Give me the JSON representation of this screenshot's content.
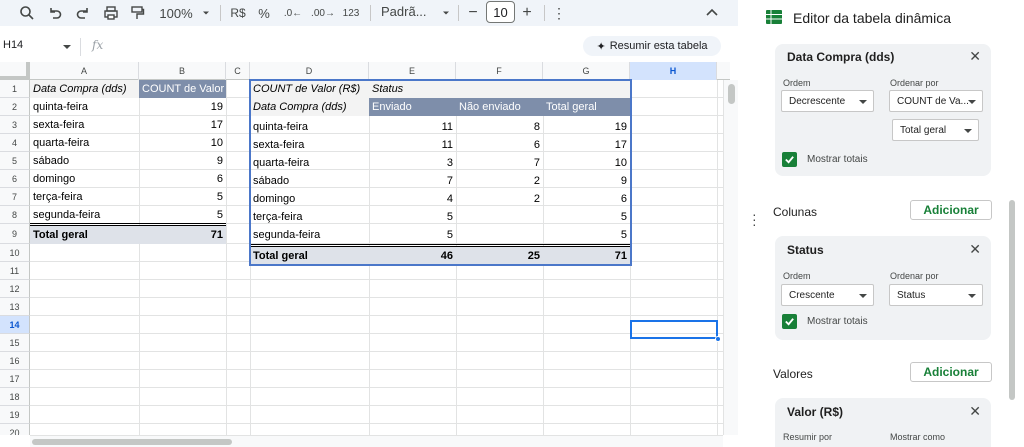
{
  "toolbar": {
    "zoom": "100%",
    "currency": "R$",
    "percent": "%",
    "dec_decrease": ".0←",
    "dec_increase": ".00→",
    "number_format": "123",
    "font": "Padrã...",
    "font_size": "10"
  },
  "formula_bar": {
    "cell_ref": "H14",
    "fx": "fx",
    "summarize_button": "Resumir esta tabela"
  },
  "grid": {
    "columns": [
      "A",
      "B",
      "C",
      "D",
      "E",
      "F",
      "G",
      "H"
    ],
    "rows": [
      "1",
      "2",
      "3",
      "4",
      "5",
      "6",
      "7",
      "8",
      "9",
      "10",
      "11",
      "12",
      "13",
      "14",
      "15",
      "16",
      "17",
      "18",
      "19",
      "20"
    ],
    "selected_column": "H",
    "selected_row": "14"
  },
  "pivot1": {
    "header_label": "Data Compra (dds)",
    "header_value": "COUNT de Valor",
    "rows": [
      {
        "label": "quinta-feira",
        "value": "19"
      },
      {
        "label": "sexta-feira",
        "value": "17"
      },
      {
        "label": "quarta-feira",
        "value": "10"
      },
      {
        "label": "sábado",
        "value": "9"
      },
      {
        "label": "domingo",
        "value": "6"
      },
      {
        "label": "terça-feira",
        "value": "5"
      },
      {
        "label": "segunda-feira",
        "value": "5"
      }
    ],
    "total_label": "Total geral",
    "total_value": "71"
  },
  "pivot2": {
    "corner_label": "COUNT de Valor (R$)",
    "status_label": "Status",
    "row_header": "Data Compra (dds)",
    "col_headers": [
      "Enviado",
      "Não enviado",
      "Total geral"
    ],
    "rows": [
      {
        "label": "quinta-feira",
        "enviado": "11",
        "nao_enviado": "8",
        "total": "19"
      },
      {
        "label": "sexta-feira",
        "enviado": "11",
        "nao_enviado": "6",
        "total": "17"
      },
      {
        "label": "quarta-feira",
        "enviado": "3",
        "nao_enviado": "7",
        "total": "10"
      },
      {
        "label": "sábado",
        "enviado": "7",
        "nao_enviado": "2",
        "total": "9"
      },
      {
        "label": "domingo",
        "enviado": "4",
        "nao_enviado": "2",
        "total": "6"
      },
      {
        "label": "terça-feira",
        "enviado": "5",
        "nao_enviado": "",
        "total": "5"
      },
      {
        "label": "segunda-feira",
        "enviado": "5",
        "nao_enviado": "",
        "total": "5"
      }
    ],
    "total_label": "Total geral",
    "total_enviado": "46",
    "total_nao_enviado": "25",
    "total_total": "71"
  },
  "panel": {
    "title": "Editor da tabela dinâmica",
    "rows_card": {
      "title": "Data Compra (dds)",
      "order_label": "Ordem",
      "order_value": "Decrescente",
      "sort_by_label": "Ordenar por",
      "sort_by_value": "COUNT de Va...",
      "sort_by_sub": "Total geral",
      "show_totals": "Mostrar totais"
    },
    "columns_section": "Colunas",
    "columns_card": {
      "title": "Status",
      "order_label": "Ordem",
      "order_value": "Crescente",
      "sort_by_label": "Ordenar por",
      "sort_by_value": "Status",
      "show_totals": "Mostrar totais"
    },
    "values_section": "Valores",
    "values_card": {
      "title": "Valor (R$)",
      "summarize_label": "Resumir por",
      "show_as_label": "Mostrar como"
    },
    "add_label": "Adicionar"
  },
  "colors": {
    "header_band": "#7e8eaa",
    "total_band": "#dee2e9",
    "selection": "#1a73e8",
    "add_green": "#188038"
  }
}
